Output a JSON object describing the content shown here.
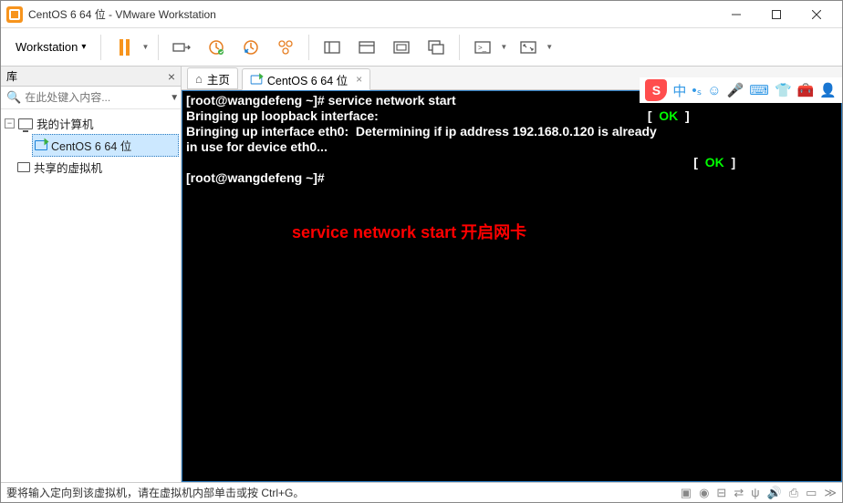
{
  "titlebar": {
    "title": "CentOS 6 64 位 - VMware Workstation"
  },
  "toolbar": {
    "menu_label": "Workstation"
  },
  "sidebar": {
    "header": "库",
    "search_placeholder": "在此处键入内容...",
    "items": {
      "root": "我的计算机",
      "vm": "CentOS 6 64 位",
      "shared": "共享的虚拟机"
    }
  },
  "tabs": {
    "home": "主页",
    "vm": "CentOS 6 64 位"
  },
  "terminal": {
    "line1": "[root@wangdefeng ~]# service network start",
    "line2": "Bringing up loopback interface:",
    "ok1_l": "[  ",
    "ok1": "OK",
    "ok1_r": "  ]",
    "line3": "Bringing up interface eth0:  Determining if ip address 192.168.0.120 is already",
    "line4": "in use for device eth0...",
    "ok2_l": "[  ",
    "ok2": "OK",
    "ok2_r": "  ]",
    "line5": "[root@wangdefeng ~]# ",
    "annotation": "service network start 开启网卡"
  },
  "statusbar": {
    "text": "要将输入定向到该虚拟机，请在虚拟机内部单击或按 Ctrl+G。"
  },
  "ime": {
    "s_label": "S",
    "cn": "中"
  }
}
